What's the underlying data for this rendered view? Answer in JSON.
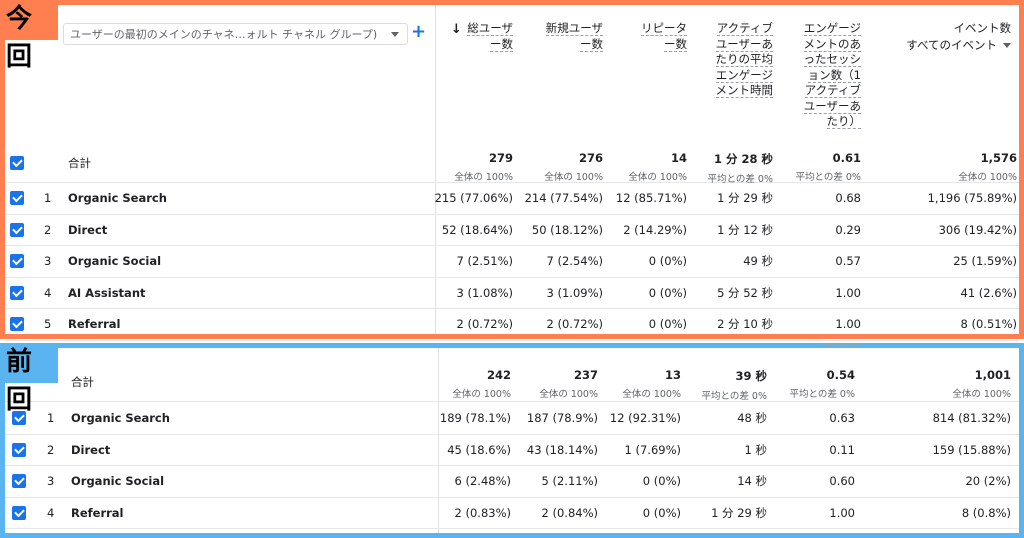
{
  "current": {
    "tag": "今回",
    "dimension_select": "ユーザーの最初のメインのチャネ…ォルト チャネル グループ)",
    "headers": {
      "total_users": [
        "総ユーザ",
        "ー数"
      ],
      "new_users": [
        "新規ユーザ",
        "ー数"
      ],
      "returning": [
        "リピータ",
        "ー数"
      ],
      "engagement_time": [
        "アクティブ",
        "ユーザーあ",
        "たりの平均",
        "エンゲージ",
        "メント時間"
      ],
      "sessions_per_user": [
        "エンゲージ",
        "メントのあ",
        "ったセッシ",
        "ョン数（1",
        "アクティブ",
        "ユーザーあ",
        "たり）"
      ],
      "event_count": "イベント数",
      "event_filter": "すべてのイベント"
    },
    "totals": {
      "label": "合計",
      "total_users": "279",
      "total_users_sub": "全体の 100%",
      "new_users": "276",
      "new_users_sub": "全体の 100%",
      "returning": "14",
      "returning_sub": "全体の 100%",
      "engagement_time": "1 分 28 秒",
      "engagement_time_sub": "平均との差 0%",
      "sessions_per_user": "0.61",
      "sessions_per_user_sub": "平均との差 0%",
      "event_count": "1,576",
      "event_count_sub": "全体の 100%"
    },
    "rows": [
      {
        "idx": "1",
        "label": "Organic Search",
        "total_users": "215 (77.06%)",
        "new_users": "214 (77.54%)",
        "returning": "12 (85.71%)",
        "engagement_time": "1 分 29 秒",
        "sessions_per_user": "0.68",
        "event_count": "1,196 (75.89%)"
      },
      {
        "idx": "2",
        "label": "Direct",
        "total_users": "52 (18.64%)",
        "new_users": "50 (18.12%)",
        "returning": "2 (14.29%)",
        "engagement_time": "1 分 12 秒",
        "sessions_per_user": "0.29",
        "event_count": "306 (19.42%)"
      },
      {
        "idx": "3",
        "label": "Organic Social",
        "total_users": "7 (2.51%)",
        "new_users": "7 (2.54%)",
        "returning": "0 (0%)",
        "engagement_time": "49 秒",
        "sessions_per_user": "0.57",
        "event_count": "25 (1.59%)"
      },
      {
        "idx": "4",
        "label": "AI Assistant",
        "total_users": "3 (1.08%)",
        "new_users": "3 (1.09%)",
        "returning": "0 (0%)",
        "engagement_time": "5 分 52 秒",
        "sessions_per_user": "1.00",
        "event_count": "41 (2.6%)"
      },
      {
        "idx": "5",
        "label": "Referral",
        "total_users": "2 (0.72%)",
        "new_users": "2 (0.72%)",
        "returning": "0 (0%)",
        "engagement_time": "2 分 10 秒",
        "sessions_per_user": "1.00",
        "event_count": "8 (0.51%)"
      }
    ]
  },
  "previous": {
    "tag": "前回",
    "totals": {
      "label": "合計",
      "total_users": "242",
      "total_users_sub": "全体の 100%",
      "new_users": "237",
      "new_users_sub": "全体の 100%",
      "returning": "13",
      "returning_sub": "全体の 100%",
      "engagement_time": "39 秒",
      "engagement_time_sub": "平均との差 0%",
      "sessions_per_user": "0.54",
      "sessions_per_user_sub": "平均との差 0%",
      "event_count": "1,001",
      "event_count_sub": "全体の 100%"
    },
    "rows": [
      {
        "idx": "1",
        "label": "Organic Search",
        "total_users": "189 (78.1%)",
        "new_users": "187 (78.9%)",
        "returning": "12 (92.31%)",
        "engagement_time": "48 秒",
        "sessions_per_user": "0.63",
        "event_count": "814 (81.32%)"
      },
      {
        "idx": "2",
        "label": "Direct",
        "total_users": "45 (18.6%)",
        "new_users": "43 (18.14%)",
        "returning": "1 (7.69%)",
        "engagement_time": "1 秒",
        "sessions_per_user": "0.11",
        "event_count": "159 (15.88%)"
      },
      {
        "idx": "3",
        "label": "Organic Social",
        "total_users": "6 (2.48%)",
        "new_users": "5 (2.11%)",
        "returning": "0 (0%)",
        "engagement_time": "14 秒",
        "sessions_per_user": "0.60",
        "event_count": "20 (2%)"
      },
      {
        "idx": "4",
        "label": "Referral",
        "total_users": "2 (0.83%)",
        "new_users": "2 (0.84%)",
        "returning": "0 (0%)",
        "engagement_time": "1 分 29 秒",
        "sessions_per_user": "1.00",
        "event_count": "8 (0.8%)"
      }
    ]
  },
  "colors": {
    "current_frame": "#ff7f50",
    "previous_frame": "#5ab4f0",
    "checkbox": "#1a73e8"
  }
}
